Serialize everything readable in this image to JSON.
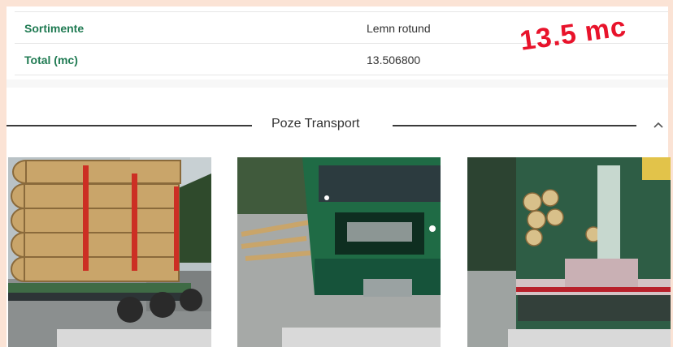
{
  "details": {
    "rows": [
      {
        "label": "Sortimente",
        "value": "Lemn rotund"
      },
      {
        "label": "Total (mc)",
        "value": "13.506800"
      }
    ]
  },
  "annotation": {
    "text": "13.5 mc",
    "color": "#e8132b"
  },
  "section": {
    "title": "Poze Transport",
    "collapse_icon": "chevron-up-icon"
  },
  "photos": [
    {
      "subject": "Log truck loaded with logs"
    },
    {
      "subject": "Green truck cab front"
    },
    {
      "subject": "Truck crane rear"
    }
  ],
  "colors": {
    "accent": "#1f7a52",
    "background": "#fbe3d5"
  }
}
